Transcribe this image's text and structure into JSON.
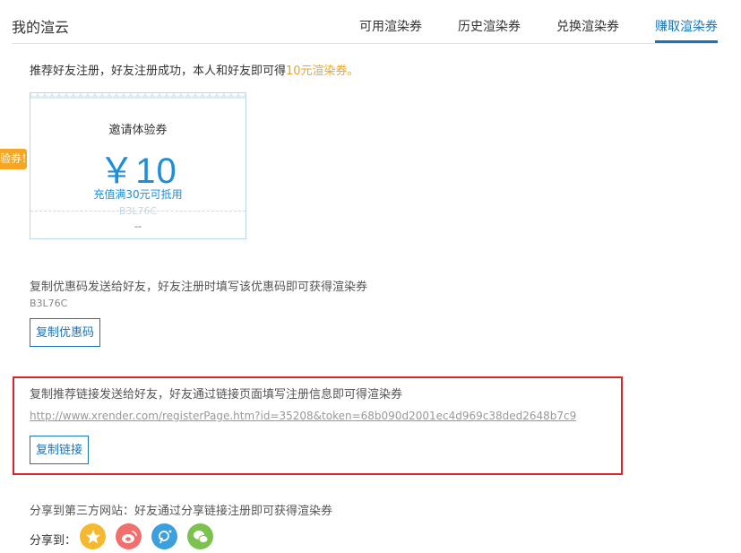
{
  "header": {
    "title": "我的渲云",
    "tabs": [
      {
        "label": "可用渲染券"
      },
      {
        "label": "历史渲染券"
      },
      {
        "label": "兑换渲染券"
      },
      {
        "label": "赚取渲染券"
      }
    ],
    "active_tab": "赚取渲染券"
  },
  "intro": {
    "text": "推荐好友注册，好友注册成功，本人和好友即可得",
    "highlight": "10元渲染券。"
  },
  "side_tag": "验券！",
  "coupon": {
    "title": "邀请体验券",
    "amount": "￥10",
    "condition": "充值满30元可抵用",
    "code": "B3L76C",
    "date": "--"
  },
  "promo_code": {
    "instruction": "复制优惠码发送给好友，好友注册时填写该优惠码即可获得渲染券",
    "code": "B3L76C",
    "button": "复制优惠码"
  },
  "referral_link": {
    "instruction": "复制推荐链接发送给好友，好友通过链接页面填写注册信息即可得渲染券",
    "url": "http://www.xrender.com/registerPage.htm?id=35208&token=68b090d2001ec4d969c38ded2648b7c9",
    "button": "复制链接"
  },
  "share": {
    "instruction": "分享到第三方网站：好友通过分享链接注册即可获得渲染券",
    "label": "分享到：",
    "icons": [
      {
        "name": "qzone-icon",
        "color": "#f5b82e"
      },
      {
        "name": "weibo-icon",
        "color": "#f16f6c"
      },
      {
        "name": "pengyou-icon",
        "color": "#3ca0dc"
      },
      {
        "name": "wechat-icon",
        "color": "#7cc24f"
      }
    ]
  },
  "colors": {
    "accent": "#1b74b7",
    "highlight": "#f3a31a",
    "coupon_blue": "#1e8ed6",
    "alert_red": "#d9252a",
    "tag_orange": "#f5a623"
  }
}
